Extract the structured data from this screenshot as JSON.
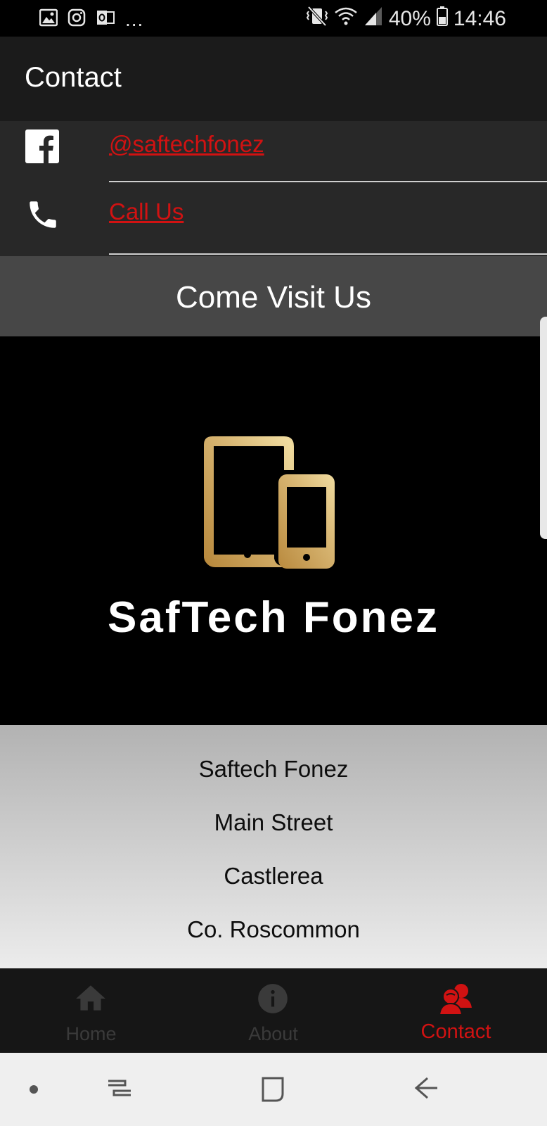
{
  "status_bar": {
    "battery": "40%",
    "time": "14:46",
    "dots": "..."
  },
  "app_bar": {
    "title": "Contact"
  },
  "contacts": {
    "facebook_label": "@saftechfonez",
    "phone_label": "Call Us"
  },
  "visit": {
    "title": "Come Visit Us"
  },
  "logo": {
    "name": "SafTech Fonez"
  },
  "address": {
    "lines": [
      "Saftech Fonez",
      "Main Street",
      "Castlerea",
      "Co. Roscommon"
    ]
  },
  "bottom_nav": {
    "items": [
      {
        "label": "Home",
        "icon": "home-icon"
      },
      {
        "label": "About",
        "icon": "info-icon"
      },
      {
        "label": "Contact",
        "icon": "contacts-icon",
        "active": true
      }
    ]
  },
  "colors": {
    "accent": "#d11212",
    "gold": "#c9a25a",
    "app_bar": "#1b1b1b",
    "rows": "#282828"
  }
}
